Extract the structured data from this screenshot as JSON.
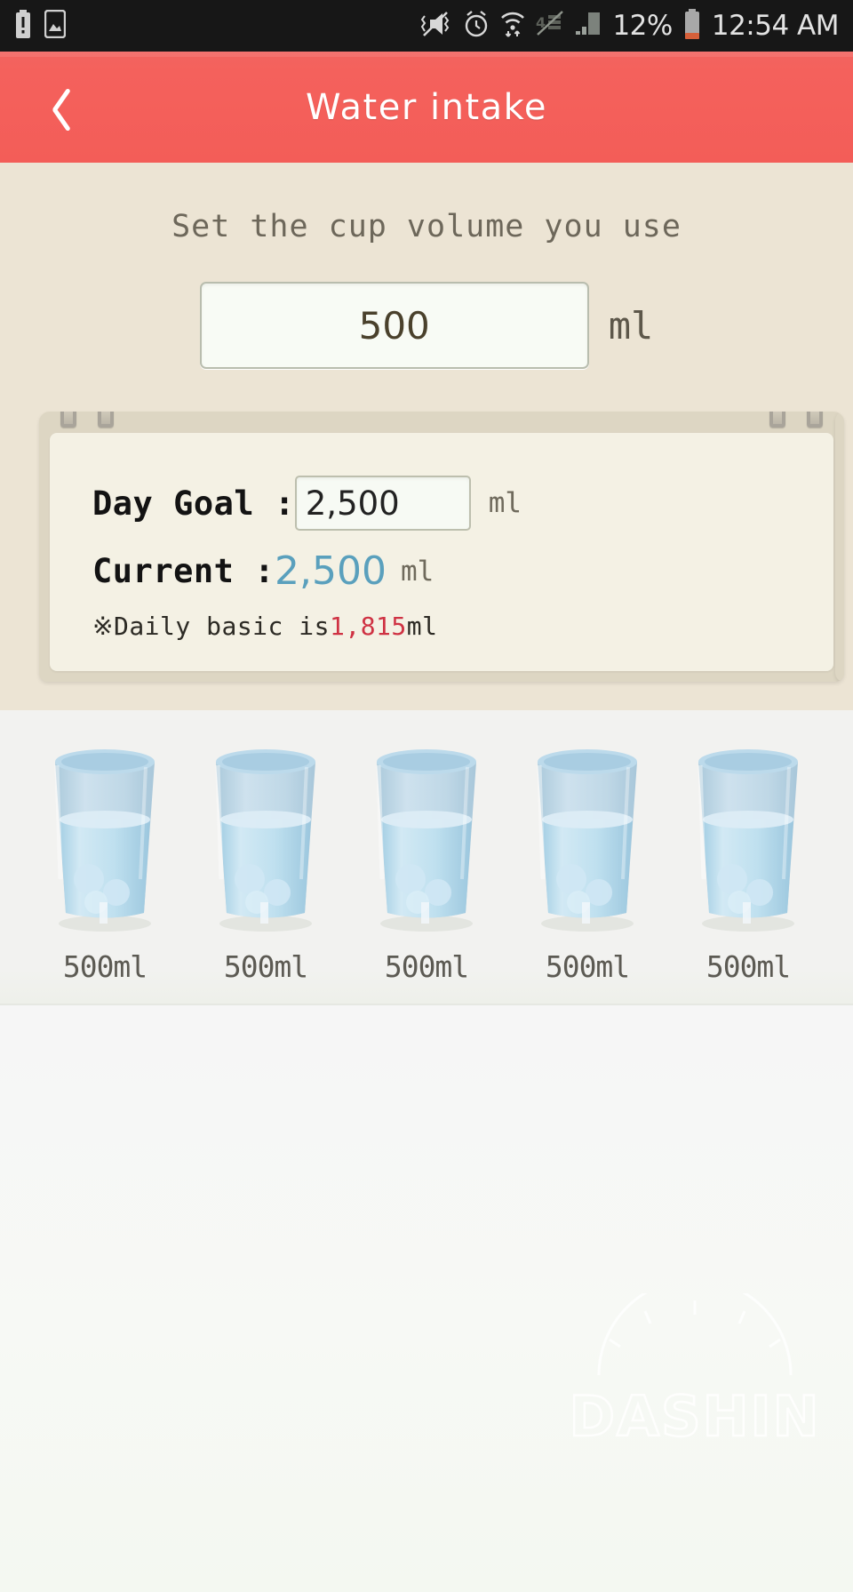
{
  "statusbar": {
    "time": "12:54 AM",
    "battery_percent": "12%",
    "left_icons": [
      "battery-alert-icon",
      "screenshot-image-icon"
    ],
    "right_icons": [
      "mute-vibrate-icon",
      "alarm-clock-icon",
      "wifi-data-icon",
      "lte-off-icon",
      "signal-bars-icon",
      "battery-icon"
    ],
    "colors": {
      "background": "#171717",
      "text": "#e3e3e3",
      "battery_fill": "#d6603a"
    }
  },
  "appbar": {
    "title": "Water intake",
    "back_icon": "chevron-left-icon",
    "color": "#f3605b"
  },
  "settings": {
    "heading": "Set the cup volume you use",
    "cup_volume_value": "500",
    "cup_volume_unit": "ml",
    "cup_volume_placeholder": "500"
  },
  "notepad": {
    "day_goal_label": "Day Goal :",
    "day_goal_value": "2,500",
    "day_goal_unit": "ml",
    "current_label": "Current :",
    "current_value": "2,500",
    "current_unit": "ml",
    "current_color": "#5aa0bd",
    "footnote_mark": "※",
    "footnote_prefix": " Daily basic is",
    "footnote_value": "1,815",
    "footnote_suffix": "ml",
    "footnote_value_color": "#cf3243"
  },
  "glasses": [
    {
      "label": "500ml",
      "name": "water-glass-1"
    },
    {
      "label": "500ml",
      "name": "water-glass-2"
    },
    {
      "label": "500ml",
      "name": "water-glass-3"
    },
    {
      "label": "500ml",
      "name": "water-glass-4"
    },
    {
      "label": "500ml",
      "name": "water-glass-5"
    }
  ],
  "watermark": {
    "text": "DASHIN"
  }
}
